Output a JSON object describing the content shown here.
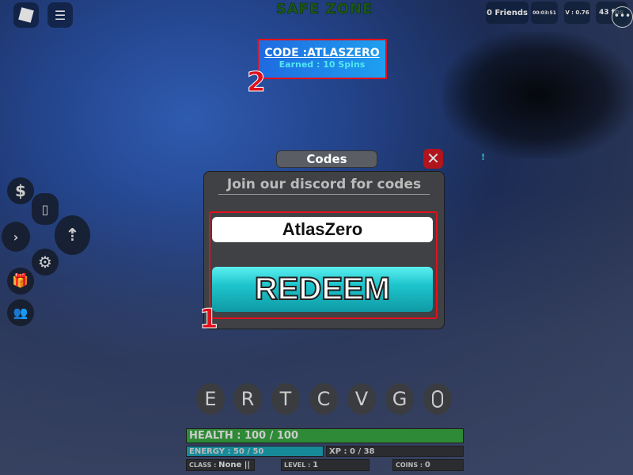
{
  "topbar": {
    "zone": "SAFE ZONE",
    "friends": "0 Friends",
    "timer": "00:03:51",
    "version": "V : 0.76",
    "fps": "43 fps"
  },
  "code_banner": {
    "title": "CODE :ATLASZERO",
    "subtitle": "Earned : 10 Spins"
  },
  "annotations": {
    "one": "1",
    "two": "2"
  },
  "dialog": {
    "tab": "Codes",
    "close": "✕",
    "header": "Join our discord for codes",
    "input_value": "AtlasZero",
    "redeem": "REDEEM"
  },
  "notice": "!",
  "keys": [
    "E",
    "R",
    "T",
    "C",
    "V",
    "G"
  ],
  "stats": {
    "health": "HEALTH : 100 / 100",
    "health_fill": 1.0,
    "energy": "ENERGY : 50 / 50",
    "energy_fill": 1.0,
    "xp": "XP : 0 / 38",
    "xp_fill": 0,
    "class_label": "CLASS :",
    "class_value": "None ||",
    "level_label": "LEVEL :",
    "level_value": "1",
    "coins_label": "COINS :",
    "coins_value": "0"
  },
  "colors": {
    "health": "#2e8a36",
    "energy": "#178a9a",
    "redeem": "#1ec5cd",
    "annotation": "#e3101c"
  }
}
